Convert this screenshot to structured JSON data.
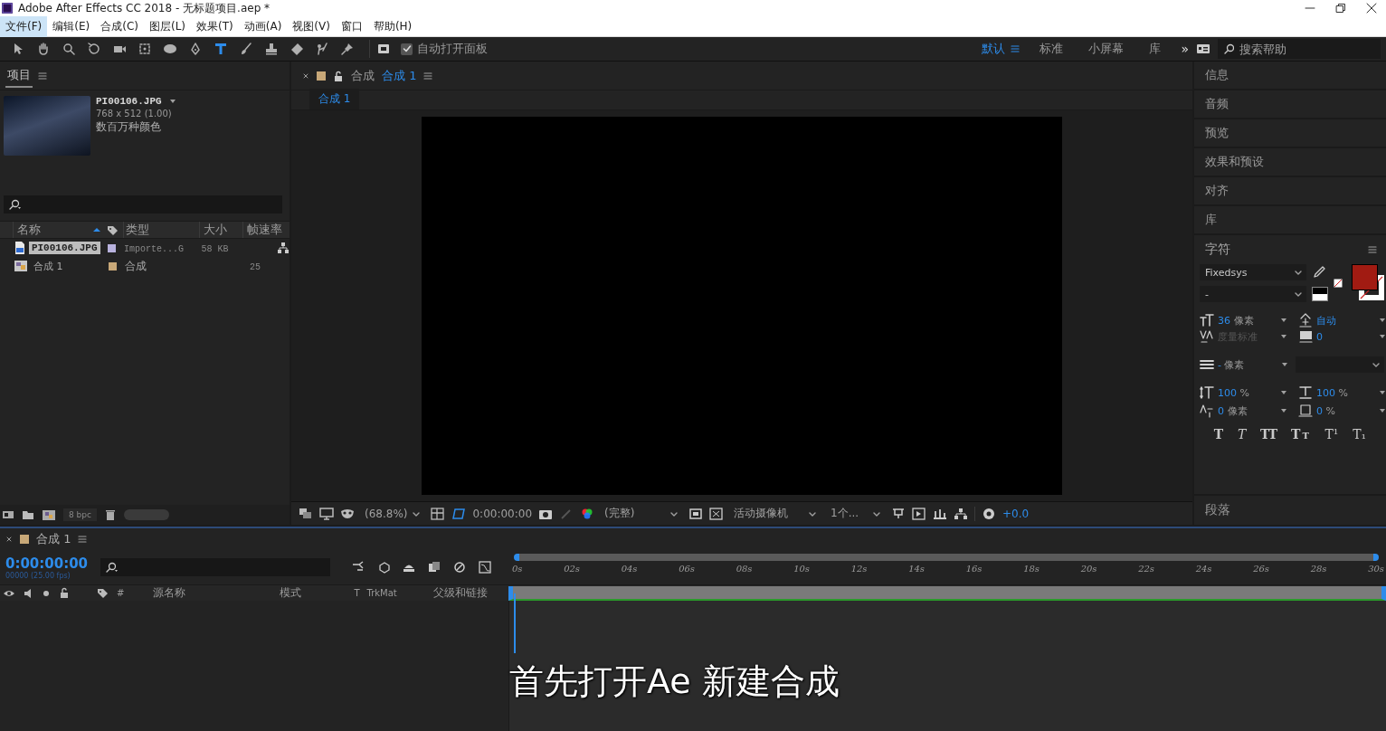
{
  "window": {
    "title": "Adobe After Effects CC 2018 - 无标题项目.aep *"
  },
  "menu": [
    {
      "label": "文件(F)",
      "selected": true
    },
    {
      "label": "编辑(E)",
      "selected": false
    },
    {
      "label": "合成(C)",
      "selected": false
    },
    {
      "label": "图层(L)",
      "selected": false
    },
    {
      "label": "效果(T)",
      "selected": false
    },
    {
      "label": "动画(A)",
      "selected": false
    },
    {
      "label": "视图(V)",
      "selected": false
    },
    {
      "label": "窗口",
      "selected": false
    },
    {
      "label": "帮助(H)",
      "selected": false
    }
  ],
  "toolbar": {
    "tools": [
      {
        "kind": "selection",
        "selected": false
      },
      {
        "kind": "hand",
        "selected": false
      },
      {
        "kind": "zoom",
        "selected": false
      },
      {
        "kind": "rotate",
        "selected": false
      },
      {
        "kind": "camera",
        "selected": false
      },
      {
        "kind": "pan",
        "selected": false
      },
      {
        "kind": "ellipse",
        "selected": false
      },
      {
        "kind": "pen",
        "selected": false
      },
      {
        "kind": "type",
        "selected": true
      },
      {
        "kind": "brush",
        "selected": false
      },
      {
        "kind": "stamp",
        "selected": false
      },
      {
        "kind": "eraser",
        "selected": false
      },
      {
        "kind": "roto",
        "selected": false
      },
      {
        "kind": "pin",
        "selected": false
      }
    ],
    "auto_open_panels": {
      "label": "自动打开面板",
      "checked": true
    },
    "workspaces": [
      {
        "label": "默认",
        "selected": true
      },
      {
        "label": "标准",
        "selected": false
      },
      {
        "label": "小屏幕",
        "selected": false
      },
      {
        "label": "库",
        "selected": false
      }
    ],
    "overflow": "»",
    "search": {
      "placeholder": "搜索帮助"
    }
  },
  "project": {
    "tab": "项目",
    "file": {
      "name": "PI00106.JPG",
      "dimensions": "768 x 512 (1.00)",
      "colors": "数百万种颜色"
    },
    "columns": [
      "名称",
      "类型",
      "大小",
      "帧速率"
    ],
    "rows": [
      {
        "kind": "footage",
        "name": "PI00106.JPG",
        "type": "Importe...G",
        "size": "58 KB",
        "color": "#b8b2de",
        "selected": true
      },
      {
        "kind": "composition",
        "name": "合成 1",
        "type": "合成",
        "fps": "25",
        "color": "#c8a878",
        "selected": false
      }
    ],
    "bit_depth": "8 bpc"
  },
  "viewer": {
    "tab_label": "合成",
    "tab_name": "合成 1",
    "subtab": "合成 1",
    "zoom": "(68.8%)",
    "timecode": "0:00:00:00",
    "resolution": "(完整)",
    "camera": "活动摄像机",
    "views": "1个...",
    "exposure": "+0.0"
  },
  "side_panels": [
    "信息",
    "音频",
    "预览",
    "效果和预设",
    "对齐",
    "库"
  ],
  "character": {
    "title": "字符",
    "font": "Fixedsys",
    "style": "-",
    "size": {
      "value": "36",
      "unit": "像素"
    },
    "leading": {
      "value": "自动"
    },
    "kerning": {
      "value": "度量标准",
      "disabled": true
    },
    "tracking": {
      "value": "0"
    },
    "stroke": {
      "value": "-",
      "unit": "像素"
    },
    "vertical_scale": {
      "value": "100",
      "unit": "%"
    },
    "horizontal_scale": {
      "value": "100",
      "unit": "%"
    },
    "baseline": {
      "value": "0",
      "unit": "像素"
    },
    "tsume": {
      "value": "0",
      "unit": "%"
    },
    "styles": [
      {
        "kind": "bold",
        "label": "T"
      },
      {
        "kind": "italic",
        "label": "T"
      },
      {
        "kind": "caps",
        "label": "TT"
      },
      {
        "kind": "smallcaps",
        "label": "TT"
      },
      {
        "kind": "super",
        "label": "T¹"
      },
      {
        "kind": "sub",
        "label": "T₁"
      }
    ]
  },
  "paragraph": {
    "title": "段落"
  },
  "timeline": {
    "tab": "合成 1",
    "time": "0:00:00:00",
    "frame_info": "00000 (25.00 fps)",
    "columns": [
      "#",
      "源名称",
      "模式",
      "T",
      "TrkMat",
      "父级和链接"
    ],
    "ruler": [
      "0s",
      "02s",
      "04s",
      "06s",
      "08s",
      "10s",
      "12s",
      "14s",
      "16s",
      "18s",
      "20s",
      "22s",
      "24s",
      "26s",
      "28s",
      "30s"
    ]
  },
  "subtitle": "首先打开Ae 新建合成"
}
